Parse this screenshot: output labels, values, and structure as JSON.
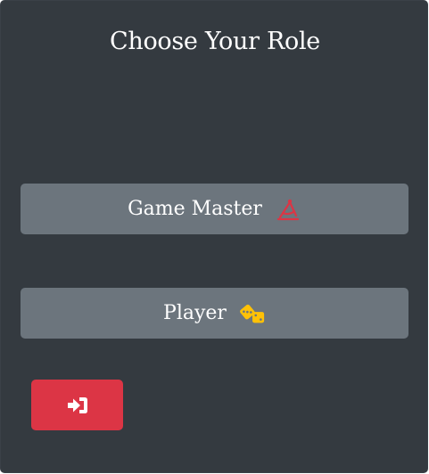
{
  "dialog": {
    "title": "Choose Your Role"
  },
  "roles": [
    {
      "label": "Game Master",
      "icon": "compass-drafting-icon",
      "icon_color": "#dc3545"
    },
    {
      "label": "Player",
      "icon": "dice-icon",
      "icon_color": "#ffc107"
    }
  ],
  "exit": {
    "icon": "sign-in-icon"
  },
  "colors": {
    "background": "#343a40",
    "role_button": "#6c757d",
    "exit_button": "#dc3545",
    "gm_icon": "#dc3545",
    "player_icon": "#ffc107"
  }
}
